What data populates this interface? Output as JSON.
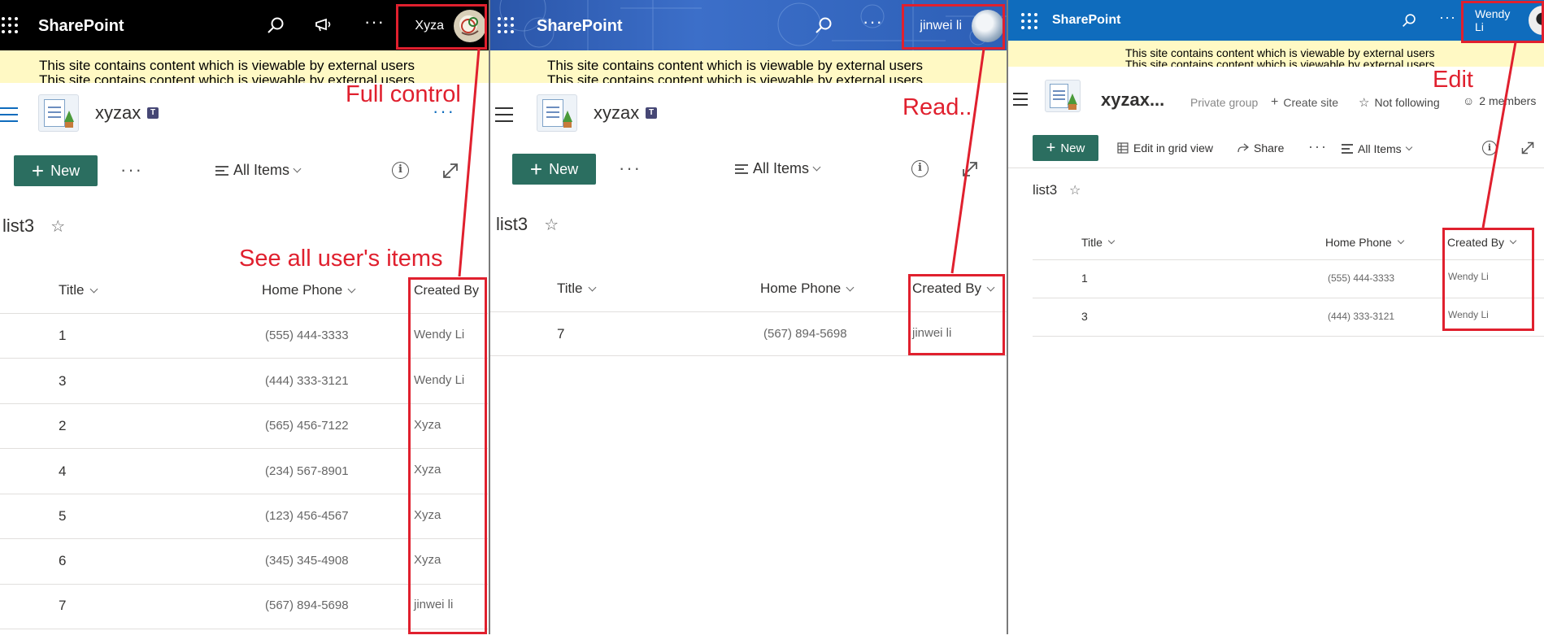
{
  "panels": [
    {
      "brand": "SharePoint",
      "user_name": "Xyza",
      "banner": "This site contains content which is viewable by external users",
      "site_name": "xyzax",
      "new_label": "New",
      "view_label": "All Items",
      "list_title": "list3",
      "columns": [
        "Title",
        "Home Phone",
        "Created By"
      ],
      "rows": [
        {
          "title": "1",
          "phone": "(555) 444-3333",
          "created_by": "Wendy Li"
        },
        {
          "title": "3",
          "phone": "(444) 333-3121",
          "created_by": "Wendy Li"
        },
        {
          "title": "2",
          "phone": "(565) 456-7122",
          "created_by": "Xyza"
        },
        {
          "title": "4",
          "phone": "(234) 567-8901",
          "created_by": "Xyza"
        },
        {
          "title": "5",
          "phone": "(123) 456-4567",
          "created_by": "Xyza"
        },
        {
          "title": "6",
          "phone": "(345) 345-4908",
          "created_by": "Xyza"
        },
        {
          "title": "7",
          "phone": "(567) 894-5698",
          "created_by": "jinwei li"
        }
      ],
      "annotations": {
        "permission": "Full control",
        "note": "See all user's items"
      }
    },
    {
      "brand": "SharePoint",
      "user_name": "jinwei li",
      "banner": "This site contains content which is viewable by external users",
      "site_name": "xyzax",
      "new_label": "New",
      "view_label": "All Items",
      "list_title": "list3",
      "columns": [
        "Title",
        "Home Phone",
        "Created By"
      ],
      "rows": [
        {
          "title": "7",
          "phone": "(567) 894-5698",
          "created_by": "jinwei li"
        }
      ],
      "annotations": {
        "permission": "Read.."
      }
    },
    {
      "brand": "SharePoint",
      "user_name": "Wendy Li",
      "banner": "This site contains content which is viewable by external users",
      "site_name": "xyzax...",
      "group_label": "Private group",
      "create_site_label": "Create site",
      "following_label": "Not following",
      "members_label": "2 members",
      "new_label": "New",
      "grid_label": "Edit in grid view",
      "share_label": "Share",
      "view_label": "All Items",
      "list_title": "list3",
      "columns": [
        "Title",
        "Home Phone",
        "Created By"
      ],
      "rows": [
        {
          "title": "1",
          "phone": "(555) 444-3333",
          "created_by": "Wendy Li"
        },
        {
          "title": "3",
          "phone": "(444) 333-3121",
          "created_by": "Wendy Li"
        }
      ],
      "annotations": {
        "permission": "Edit"
      }
    }
  ],
  "colors": {
    "suitebar_black": "#000000",
    "suitebar_pattern": "#2a55a8",
    "suitebar_blue": "#0f6cbd",
    "banner_yellow": "#fff9c4",
    "new_button": "#2b6e60",
    "annotation_red": "#e0202e"
  },
  "icons": [
    "waffle-icon",
    "search-icon",
    "megaphone-icon",
    "more-icon",
    "hamburger-icon",
    "teams-icon",
    "plus-icon",
    "list-view-icon",
    "chevron-down-icon",
    "filter-icon",
    "info-icon",
    "expand-icon",
    "star-icon",
    "grid-icon",
    "share-icon",
    "person-icon"
  ]
}
